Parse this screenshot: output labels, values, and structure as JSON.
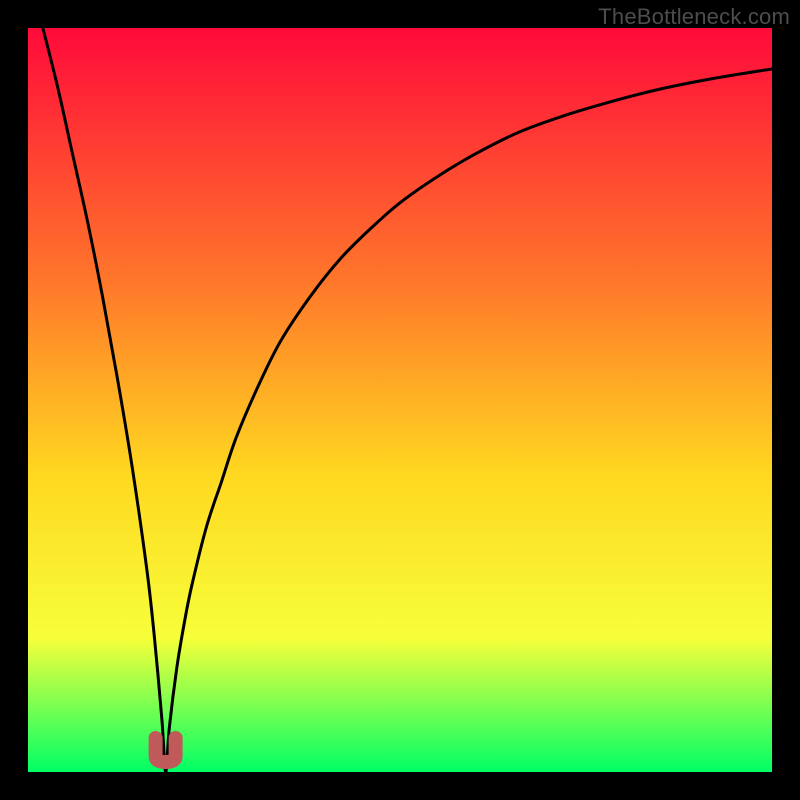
{
  "watermark": "TheBottleneck.com",
  "colors": {
    "black": "#000000",
    "curve": "#000000",
    "marker": "#c05a5a",
    "gradient_top": "#ff0a3a",
    "gradient_mid_upper": "#ff7a2a",
    "gradient_mid": "#ffd820",
    "gradient_mid_lower": "#f7ff3a",
    "gradient_bottom": "#00ff66"
  },
  "chart_data": {
    "type": "line",
    "title": "",
    "xlabel": "",
    "ylabel": "",
    "xlim": [
      0,
      100
    ],
    "ylim": [
      0,
      100
    ],
    "grid": false,
    "legend": false,
    "optimum_x": 18.5,
    "series": [
      {
        "name": "bottleneck-curve",
        "x": [
          2,
          4,
          6,
          8,
          10,
          12,
          14,
          16,
          17,
          18,
          18.5,
          19,
          20,
          21,
          22,
          24,
          26,
          28,
          31,
          34,
          38,
          42,
          46,
          50,
          55,
          60,
          66,
          72,
          78,
          85,
          92,
          100
        ],
        "values": [
          100,
          92,
          83,
          74,
          64,
          53,
          41,
          27,
          18,
          7,
          0,
          6,
          14,
          20,
          25,
          33,
          39,
          45,
          52,
          58,
          64,
          69,
          73,
          76.5,
          80,
          83,
          86,
          88.2,
          90,
          91.8,
          93.2,
          94.5
        ]
      }
    ],
    "annotations": [
      {
        "name": "optimum-marker",
        "shape": "u",
        "x": 18.5,
        "y": 0
      }
    ]
  }
}
